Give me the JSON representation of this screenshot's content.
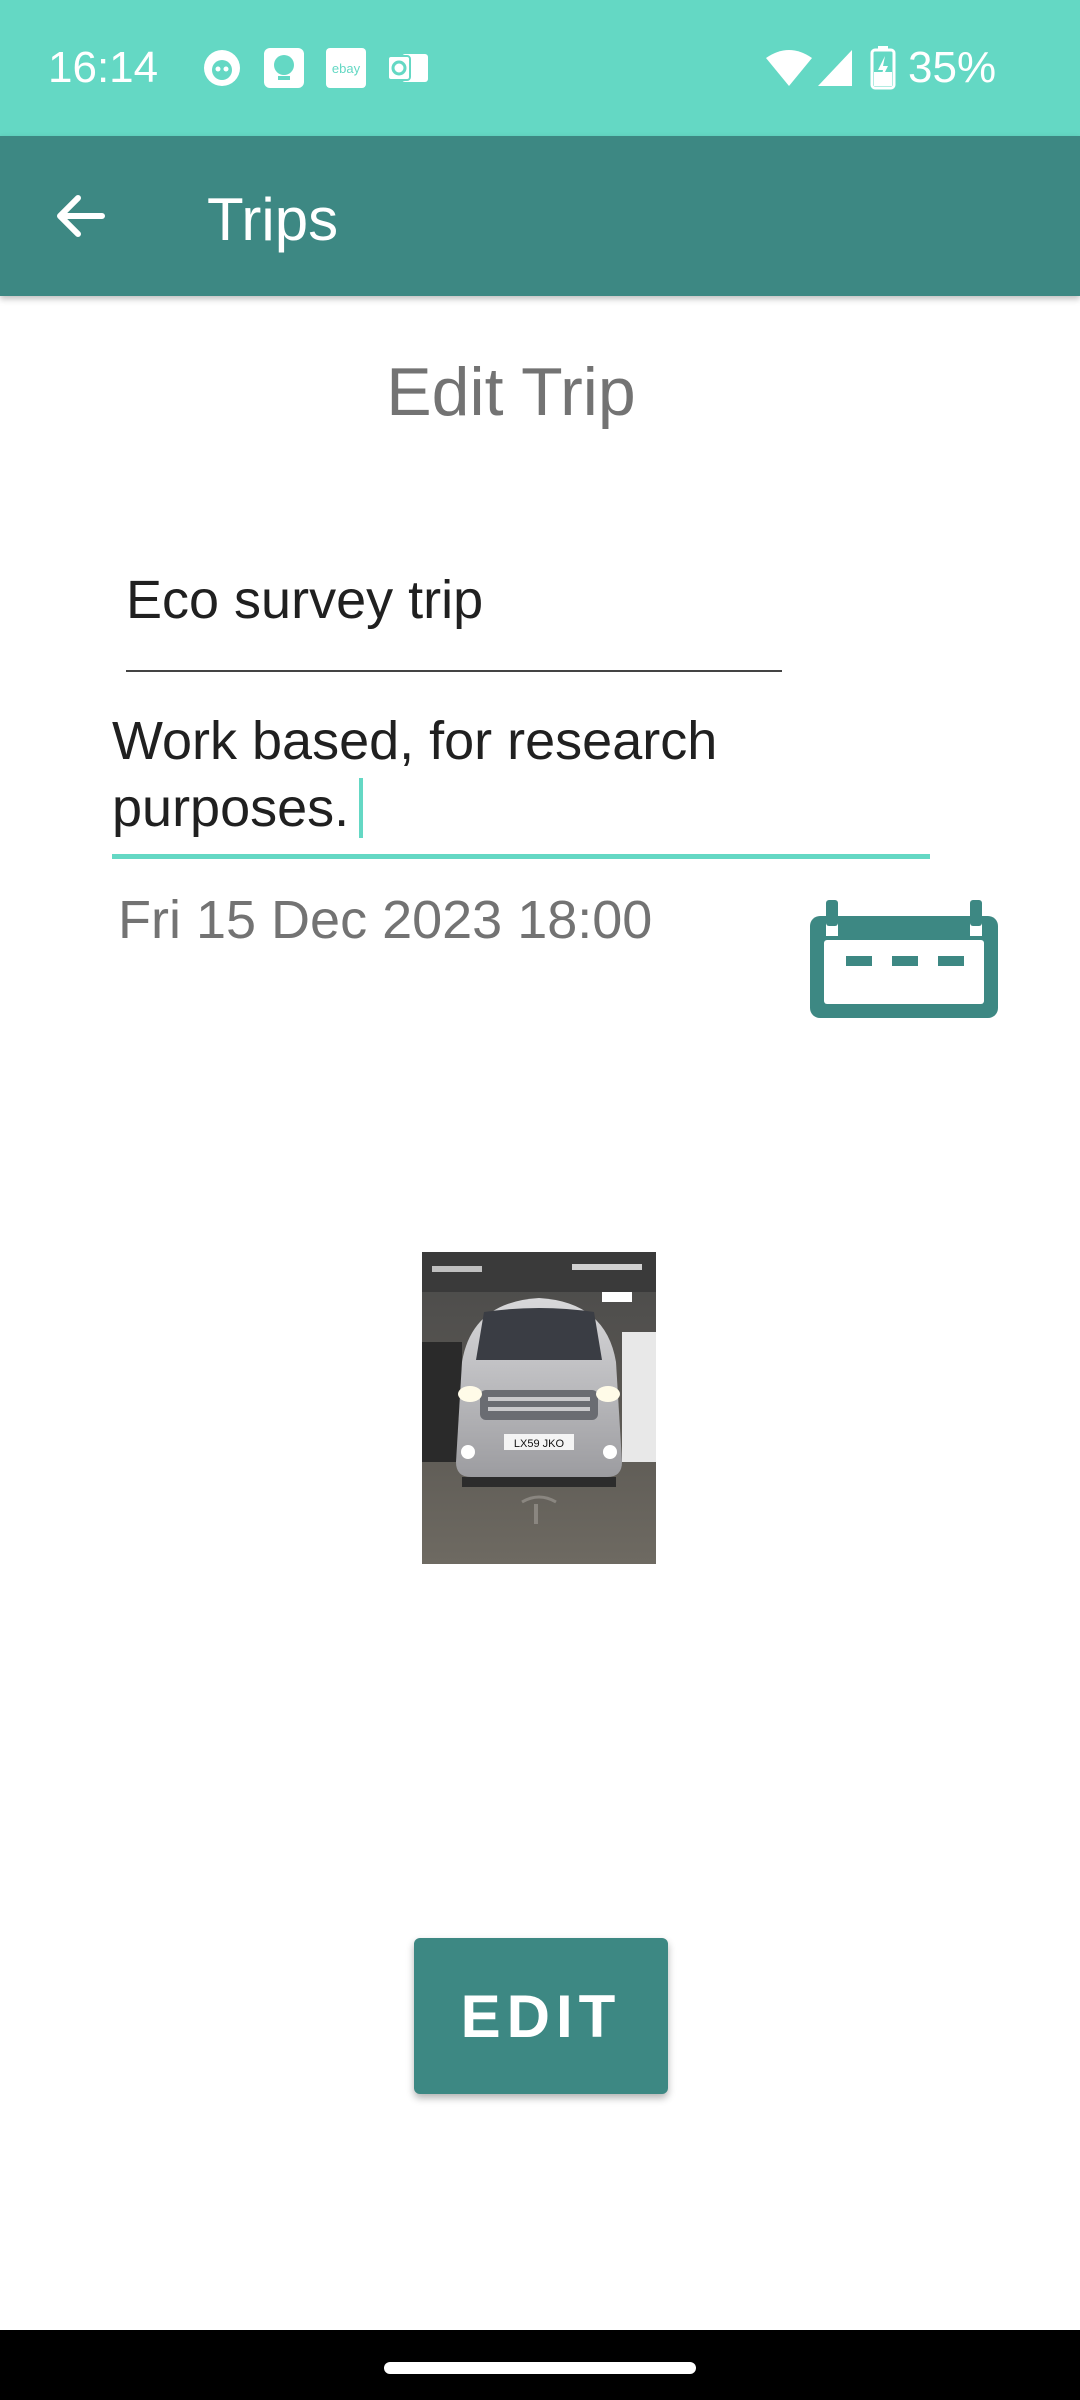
{
  "status_bar": {
    "time": "16:14",
    "battery": "35%",
    "notification_icons": [
      "app-icon",
      "chat-icon",
      "ebay-icon",
      "outlook-icon"
    ]
  },
  "app_bar": {
    "title": "Trips",
    "back_icon": "arrow-left-icon"
  },
  "form": {
    "heading": "Edit Trip",
    "trip_name": "Eco survey trip",
    "description_line1": "Work based, for research",
    "description_line2": "purposes.",
    "date": "Fri 15 Dec 2023 18:00",
    "calendar_icon": "calendar-icon",
    "photo_plate": "LX59 JKO"
  },
  "actions": {
    "edit_label": "EDIT"
  },
  "colors": {
    "status_bar": "#64d8c4",
    "app_bar": "#3d8883",
    "accent": "#64d8c4",
    "button": "#3d8883"
  }
}
